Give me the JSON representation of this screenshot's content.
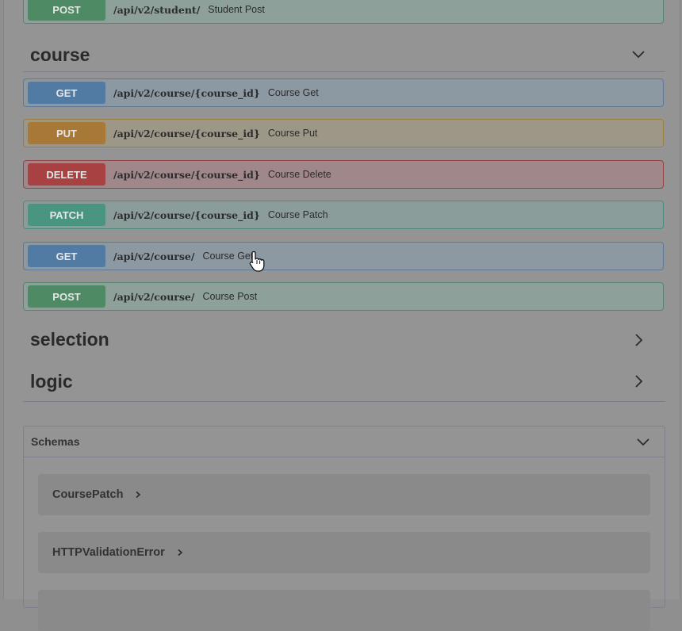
{
  "operations": [
    {
      "method": "POST",
      "path": "/api/v2/student/",
      "summary": "Student Post"
    },
    {
      "method": "GET",
      "path": "/api/v2/course/{course_id}",
      "summary": "Course Get"
    },
    {
      "method": "PUT",
      "path": "/api/v2/course/{course_id}",
      "summary": "Course Put"
    },
    {
      "method": "DELETE",
      "path": "/api/v2/course/{course_id}",
      "summary": "Course Delete"
    },
    {
      "method": "PATCH",
      "path": "/api/v2/course/{course_id}",
      "summary": "Course Patch"
    },
    {
      "method": "GET",
      "path": "/api/v2/course/",
      "summary": "Course Get"
    },
    {
      "method": "POST",
      "path": "/api/v2/course/",
      "summary": "Course Post"
    }
  ],
  "tags": {
    "course": "course",
    "selection": "selection",
    "logic": "logic"
  },
  "schemas": {
    "title": "Schemas",
    "models": [
      "CoursePatch",
      "HTTPValidationError"
    ]
  },
  "colors": {
    "get": "#527ba4",
    "post": "#4e8a63",
    "put": "#a87836",
    "delete": "#a84141",
    "patch": "#4a9482"
  },
  "icons": {
    "expanded": "chevron-down-icon",
    "collapsed": "chevron-right-icon",
    "cursor": "hand-pointer-cursor-icon"
  }
}
